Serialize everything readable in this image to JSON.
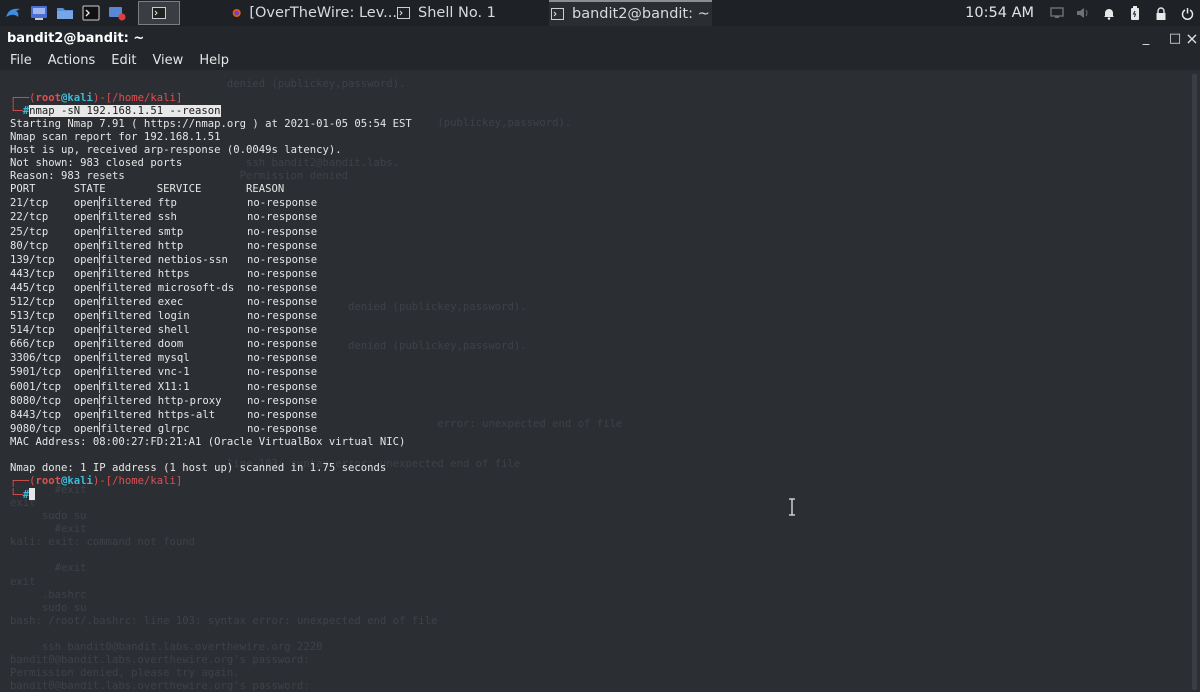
{
  "taskbar": {
    "tasks": [
      {
        "label": "[OverTheWire: Lev...",
        "icon": "firefox-icon"
      },
      {
        "label": "Shell No. 1",
        "icon": "terminal-icon"
      },
      {
        "label": "bandit2@bandit: ~",
        "icon": "terminal-icon"
      }
    ],
    "clock": "10:54 AM"
  },
  "window": {
    "title": "bandit2@bandit: ~",
    "minimize": "_",
    "maximize": "□",
    "close": "×"
  },
  "menu": [
    "File",
    "Actions",
    "Edit",
    "View",
    "Help"
  ],
  "terminal": {
    "prompt": {
      "user": "root",
      "at": "@",
      "host": "kali",
      "path": "/home/kali",
      "symbol": "#"
    },
    "command": "nmap -sN 192.168.1.51 --reason",
    "header_lines": [
      "Starting Nmap 7.91 ( https://nmap.org ) at 2021-01-05 05:54 EST",
      "Nmap scan report for 192.168.1.51",
      "Host is up, received arp-response (0.0049s latency).",
      "Not shown: 983 closed ports",
      "Reason: 983 resets"
    ],
    "table_header": [
      "PORT",
      "STATE",
      "SERVICE",
      "REASON"
    ],
    "ports": [
      [
        "21/tcp",
        "open|filtered",
        "ftp",
        "no-response"
      ],
      [
        "22/tcp",
        "open|filtered",
        "ssh",
        "no-response"
      ],
      [
        "25/tcp",
        "open|filtered",
        "smtp",
        "no-response"
      ],
      [
        "80/tcp",
        "open|filtered",
        "http",
        "no-response"
      ],
      [
        "139/tcp",
        "open|filtered",
        "netbios-ssn",
        "no-response"
      ],
      [
        "443/tcp",
        "open|filtered",
        "https",
        "no-response"
      ],
      [
        "445/tcp",
        "open|filtered",
        "microsoft-ds",
        "no-response"
      ],
      [
        "512/tcp",
        "open|filtered",
        "exec",
        "no-response"
      ],
      [
        "513/tcp",
        "open|filtered",
        "login",
        "no-response"
      ],
      [
        "514/tcp",
        "open|filtered",
        "shell",
        "no-response"
      ],
      [
        "666/tcp",
        "open|filtered",
        "doom",
        "no-response"
      ],
      [
        "3306/tcp",
        "open|filtered",
        "mysql",
        "no-response"
      ],
      [
        "5901/tcp",
        "open|filtered",
        "vnc-1",
        "no-response"
      ],
      [
        "6001/tcp",
        "open|filtered",
        "X11:1",
        "no-response"
      ],
      [
        "8080/tcp",
        "open|filtered",
        "http-proxy",
        "no-response"
      ],
      [
        "8443/tcp",
        "open|filtered",
        "https-alt",
        "no-response"
      ],
      [
        "9080/tcp",
        "open|filtered",
        "glrpc",
        "no-response"
      ]
    ],
    "mac_line": "MAC Address: 08:00:27:FD:21:A1 (Oracle VirtualBox virtual NIC)",
    "done_line": "Nmap done: 1 IP address (1 host up) scanned in 1.75 seconds",
    "ghost_lines": [
      "                                  denied (publickey,password).",
      "",
      "",
      "                                                                   (publickey,password).",
      "",
      "",
      "                                     ssh bandit2@bandit.labs.",
      "                                    Permission denied",
      "",
      "",
      "",
      "",
      "",
      "",
      "",
      "",
      "",
      "                                                     denied (publickey,password).",
      "",
      "",
      "                                                     denied (publickey,password).",
      "",
      "",
      "",
      "",
      "",
      "                                                                   error: unexpected end of file",
      "",
      "",
      "                                  line 103: syntax error: unexpected end of file",
      "",
      "       #exit",
      "exit",
      "     sudo su",
      "       #exit",
      "kali: exit: command not found",
      "",
      "       #exit",
      "exit",
      "     .bashrc",
      "     sudo su",
      "bash: /root/.bashrc: line 103: syntax error: unexpected end of file",
      "",
      "     ssh bandit0@bandit.labs.overthewire.org 2220",
      "bandit0@bandit.labs.overthewire.org's password:",
      "Permission denied, please try again.",
      "bandit0@bandit.labs.overthewire.org's password:"
    ]
  }
}
